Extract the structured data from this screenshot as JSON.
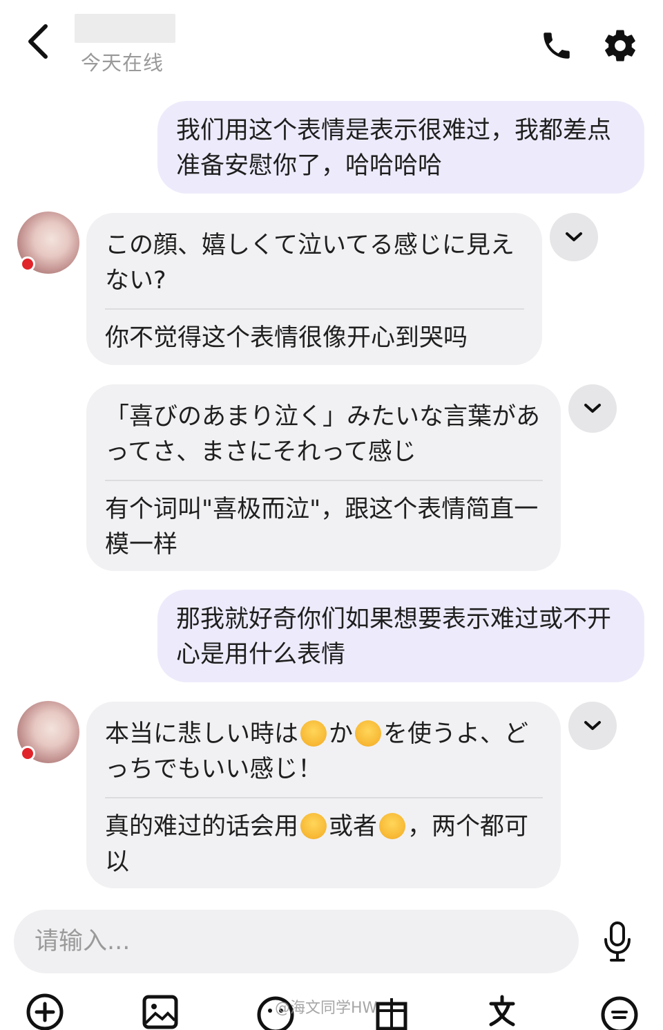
{
  "header": {
    "status": "今天在线",
    "back_icon": "chevron-left-icon",
    "call_icon": "phone-icon",
    "settings_icon": "gear-icon"
  },
  "messages": [
    {
      "side": "out",
      "text": "我们用这个表情是表示很难过，我都差点准备安慰你了，哈哈哈哈"
    },
    {
      "side": "in",
      "original": "この顔、嬉しくて泣いてる感じに見えない?",
      "translation": "你不觉得这个表情很像开心到哭吗"
    },
    {
      "side": "in",
      "original": "「喜びのあまり泣く」みたいな言葉があってさ、まさにそれって感じ",
      "translation": "有个词叫\"喜极而泣\"，跟这个表情简直一模一样"
    },
    {
      "side": "out",
      "text": "那我就好奇你们如果想要表示难过或不开心是用什么表情"
    },
    {
      "side": "in",
      "original_a": "本当に悲しい時は",
      "original_b": "か",
      "original_c": "を使うよ、どっちでもいい感じ！",
      "translation_a": "真的难过的话会用",
      "translation_b": "或者",
      "translation_c": "，两个都可以",
      "emojis": [
        "pleading-face-icon",
        "pensive-face-icon"
      ]
    }
  ],
  "input": {
    "placeholder": "请输入..."
  },
  "toolbar": [
    "add-icon",
    "image-icon",
    "emoji-icon",
    "gift-icon",
    "translate-icon",
    "menu-icon"
  ],
  "watermark": "@海文同学HW",
  "colors": {
    "outgoing_bubble": "#edebfb",
    "incoming_bubble": "#f1f1f3",
    "online_dot": "#e0242a"
  }
}
